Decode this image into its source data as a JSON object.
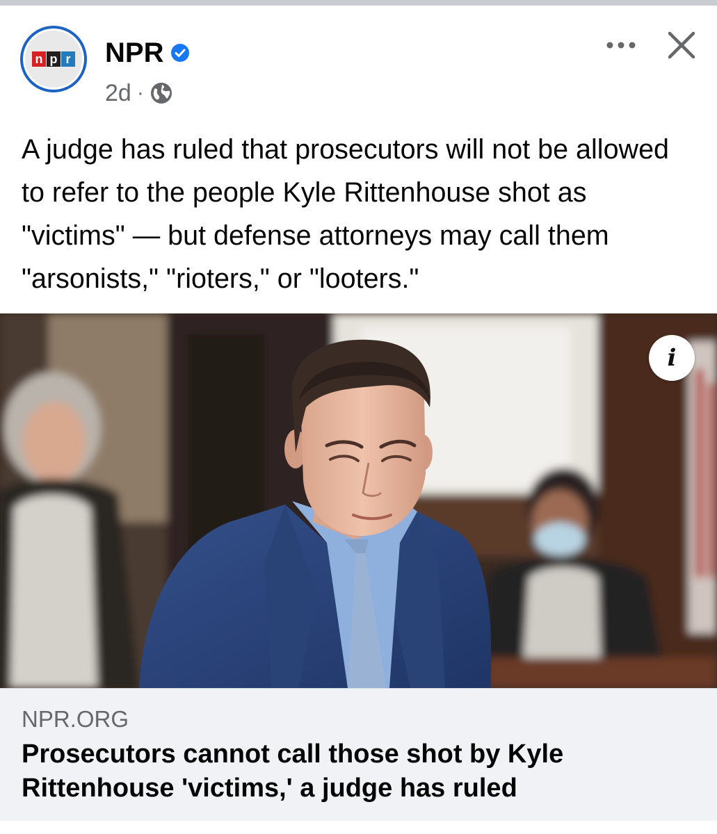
{
  "post": {
    "author": {
      "name": "NPR",
      "verified": true,
      "logo_letters": [
        "n",
        "p",
        "r"
      ],
      "logo_colors": [
        "#d62021",
        "#231f20",
        "#237bbd"
      ]
    },
    "timestamp": "2d",
    "separator": "·",
    "audience_icon": "globe-icon",
    "text": "A judge has ruled that prosecutors will not be allowed to refer to the people Kyle Rittenhouse shot as \"victims\" — but defense attorneys may call them \"arsonists,\" \"rioters,\" or \"looters.\"",
    "image": {
      "info_label": "i"
    },
    "link": {
      "domain": "NPR.ORG",
      "headline": "Prosecutors cannot call those shot by Kyle Rittenhouse 'victims,' a judge has ruled"
    }
  },
  "colors": {
    "brand_blue": "#1d63c4",
    "verified_blue": "#1877f2",
    "secondary_text": "#65676b",
    "card_background": "#f0f2f5"
  }
}
